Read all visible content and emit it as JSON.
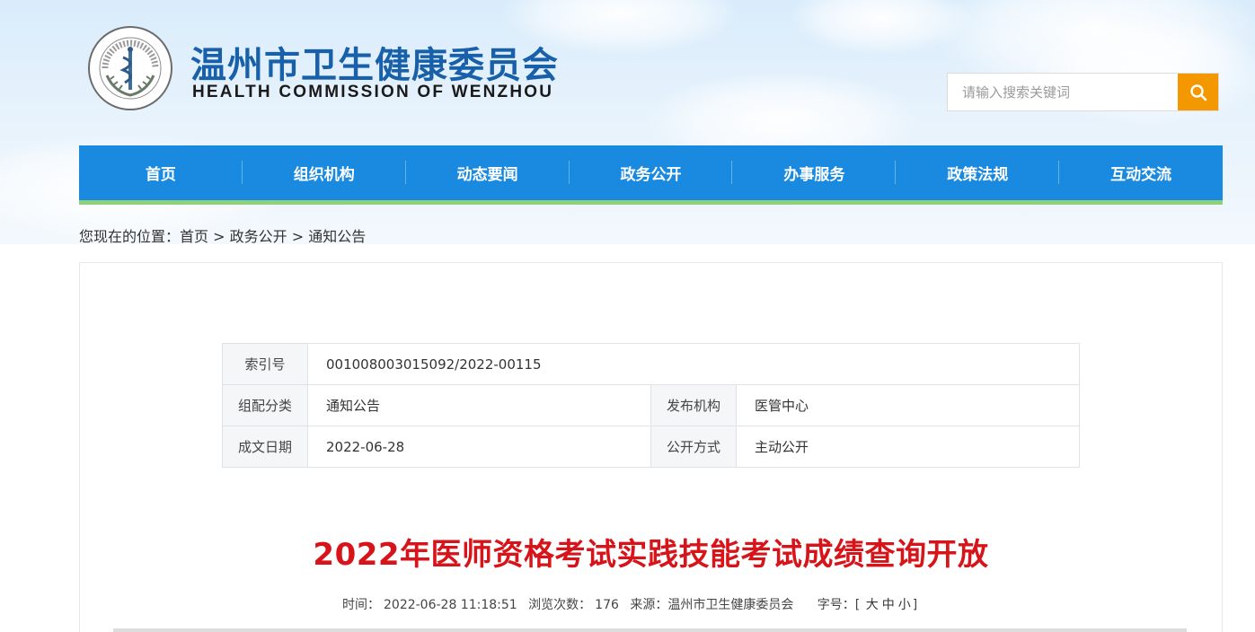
{
  "header": {
    "title_cn": "温州市卫生健康委员会",
    "title_en": "HEALTH COMMISSION OF WENZHOU",
    "seal_text": "温州市卫生健康委员会 Health Commission of Wenzhou"
  },
  "search": {
    "placeholder": "请输入搜索关键词",
    "button_color": "#f39800"
  },
  "nav": {
    "items": [
      "首页",
      "组织机构",
      "动态要闻",
      "政务公开",
      "办事服务",
      "政策法规",
      "互动交流"
    ],
    "color": "#1a8ae0",
    "accent": "#8fd07a"
  },
  "breadcrumb": {
    "prefix": "您现在的位置：",
    "items": [
      "首页",
      "政务公开",
      "通知公告"
    ],
    "separator": ">"
  },
  "meta": {
    "index_label": "索引号",
    "index_value": "001008003015092/2022-00115",
    "category_label": "组配分类",
    "category_value": "通知公告",
    "publisher_label": "发布机构",
    "publisher_value": "医管中心",
    "date_label": "成文日期",
    "date_value": "2022-06-28",
    "disclosure_label": "公开方式",
    "disclosure_value": "主动公开"
  },
  "article": {
    "title": "2022年医师资格考试实践技能考试成绩查询开放",
    "title_color": "#d8141b",
    "time_label": "时间：",
    "time_value": "2022-06-28 11:18:51",
    "views_label": "浏览次数：",
    "views_value": "176",
    "source_label": "来源：",
    "source_value": "温州市卫生健康委员会",
    "fontsize_label": "字号：",
    "fontsize_open": "[",
    "fontsize_large": "大",
    "fontsize_medium": "中",
    "fontsize_small": "小",
    "fontsize_close": "]"
  }
}
